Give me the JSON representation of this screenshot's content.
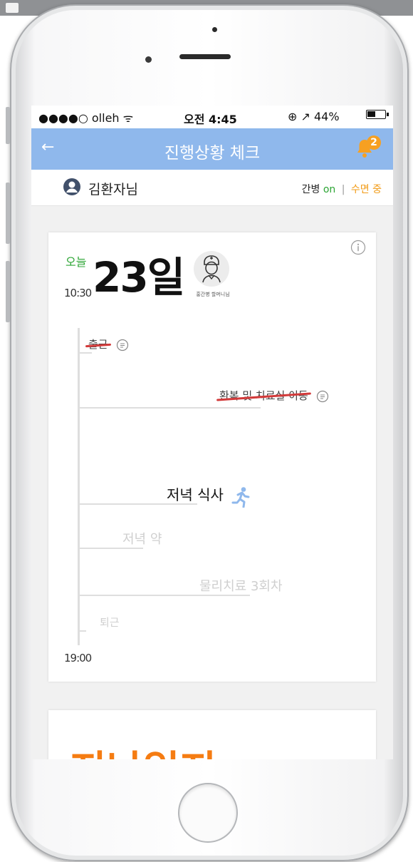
{
  "status_bar": {
    "carrier": "●●●●○ olleh ᯤ",
    "time": "오전 4:45",
    "right": "⊕ ↗ 44%"
  },
  "header": {
    "back_glyph": "←",
    "title": "진행상황 체크",
    "notification_count": "2"
  },
  "patient": {
    "name": "김환자님",
    "care_label": "간병",
    "care_on": "on",
    "separator": "|",
    "sleep_status": "수면 중"
  },
  "card": {
    "today_label": "오늘",
    "day": "23일",
    "nurse_label": "홍간병 할머니님",
    "time_start": "10:30",
    "time_end": "19:00",
    "items": [
      {
        "label": "출근",
        "state": "done",
        "icon": "memo-icon"
      },
      {
        "label": "환복 및 치료실 이동",
        "state": "done",
        "icon": "memo-icon"
      },
      {
        "label": "저녁 식사",
        "state": "current",
        "icon": "running-person-icon"
      },
      {
        "label": "저녁 약",
        "state": "upcoming"
      },
      {
        "label": "물리치료 3회차",
        "state": "upcoming"
      },
      {
        "label": "퇴근",
        "state": "upcoming"
      }
    ]
  },
  "next_card": {
    "title": "지난일지"
  },
  "colors": {
    "appbar": "#8fb8ec",
    "green": "#2ca534",
    "orange": "#f29b16",
    "strike": "#d23a3a",
    "badge": "#f7a021"
  }
}
